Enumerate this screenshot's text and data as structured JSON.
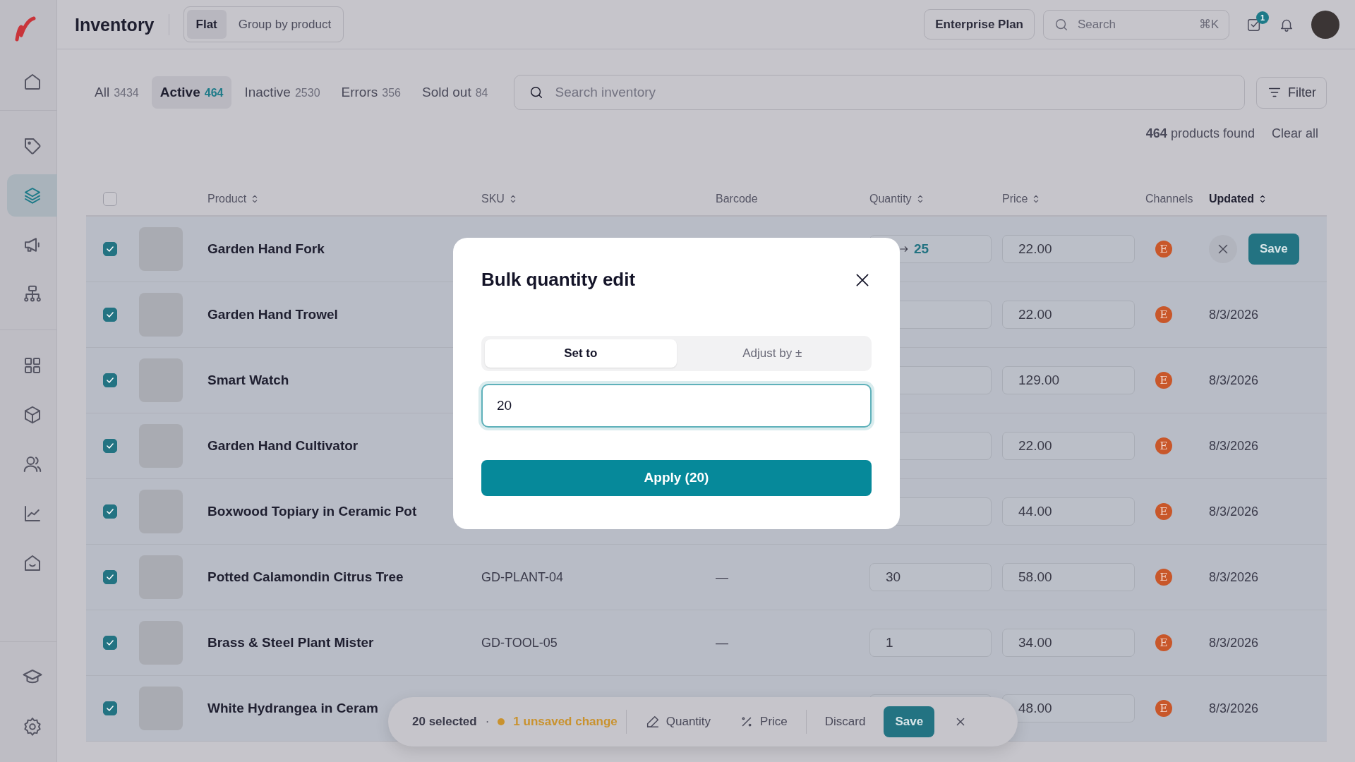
{
  "sidebar": {
    "groups": [
      [
        {
          "selected": false
        }
      ],
      [
        {
          "selected": false
        },
        {
          "selected": true
        },
        {
          "selected": false
        },
        {
          "selected": false
        }
      ],
      [
        {
          "selected": false
        },
        {
          "selected": false
        },
        {
          "selected": false
        },
        {
          "selected": false
        },
        {
          "selected": false
        }
      ],
      [
        {
          "selected": false
        },
        {
          "selected": false
        }
      ]
    ]
  },
  "header": {
    "title": "Inventory",
    "views": [
      {
        "label": "Flat",
        "selected": true
      },
      {
        "label": "Group by product",
        "selected": false
      }
    ],
    "plan": "Enterprise Plan",
    "search": {
      "placeholder": "Search",
      "shortcut": "⌘K"
    },
    "tasks_badge": "1"
  },
  "status_tabs": [
    {
      "label": "All",
      "count": "3434",
      "selected": false
    },
    {
      "label": "Active",
      "count": "464",
      "selected": true
    },
    {
      "label": "Inactive",
      "count": "2530",
      "selected": false
    },
    {
      "label": "Errors",
      "count": "356",
      "selected": false
    },
    {
      "label": "Sold out",
      "count": "84",
      "selected": false
    }
  ],
  "search": {
    "placeholder": "Search inventory"
  },
  "filter": "Filter",
  "results": {
    "text": "**464** products found",
    "clear": "Clear all"
  },
  "table": {
    "header_checked": false,
    "columns": [
      {
        "label": "Product",
        "sortable": true,
        "sorted": false
      },
      {
        "label": "SKU",
        "sortable": true,
        "sorted": false
      },
      {
        "label": "Barcode",
        "sortable": false,
        "sorted": false
      },
      {
        "label": "Quantity",
        "sortable": true,
        "sorted": false
      },
      {
        "label": "Price",
        "sortable": true,
        "sorted": false
      },
      {
        "label": "Channels",
        "sortable": false,
        "sorted": false
      },
      {
        "label": "Updated",
        "sortable": true,
        "sorted": true
      }
    ],
    "rows": [
      {
        "name": "Garden Hand Fork",
        "checked": true,
        "quantity": "25",
        "quantity_changed": true,
        "price": "22.00",
        "channel": "E",
        "editing": true,
        "save": "Save"
      },
      {
        "name": "Garden Hand Trowel",
        "checked": true,
        "price": "22.00",
        "channel": "E",
        "editing": false,
        "updated": "8/3/2026"
      },
      {
        "name": "Smart Watch",
        "checked": true,
        "price": "129.00",
        "channel": "E",
        "editing": false,
        "updated": "8/3/2026"
      },
      {
        "name": "Garden Hand Cultivator",
        "checked": true,
        "price": "22.00",
        "channel": "E",
        "editing": false,
        "updated": "8/3/2026"
      },
      {
        "name": "Boxwood Topiary in Ceramic Pot",
        "checked": true,
        "price": "44.00",
        "channel": "E",
        "editing": false,
        "updated": "8/3/2026"
      },
      {
        "name": "Potted Calamondin Citrus Tree",
        "checked": true,
        "sku": "GD-PLANT-04",
        "barcode": "—",
        "quantity": "30",
        "quantity_changed": false,
        "price": "58.00",
        "channel": "E",
        "editing": false,
        "updated": "8/3/2026"
      },
      {
        "name": "Brass & Steel Plant Mister",
        "checked": true,
        "sku": "GD-TOOL-05",
        "barcode": "—",
        "quantity": "1",
        "quantity_changed": false,
        "price": "34.00",
        "channel": "E",
        "editing": false,
        "updated": "8/3/2026"
      },
      {
        "name": "White Hydrangea in Ceram",
        "checked": true,
        "price": "48.00",
        "channel": "E",
        "editing": false,
        "updated": "8/3/2026"
      }
    ]
  },
  "bulk_bar": {
    "selected": "20 selected",
    "separator": "·",
    "unsaved": "1 unsaved change",
    "actions": [
      {
        "label": "Quantity",
        "kind": "edit"
      },
      {
        "label": "Price",
        "kind": "percent"
      }
    ],
    "discard": "Discard",
    "save": "Save"
  },
  "modal": {
    "title": "Bulk quantity edit",
    "modes": [
      {
        "label": "Set to",
        "selected": true
      },
      {
        "label": "Adjust by ±",
        "selected": false
      }
    ],
    "value": "20",
    "apply": "Apply (20)"
  }
}
